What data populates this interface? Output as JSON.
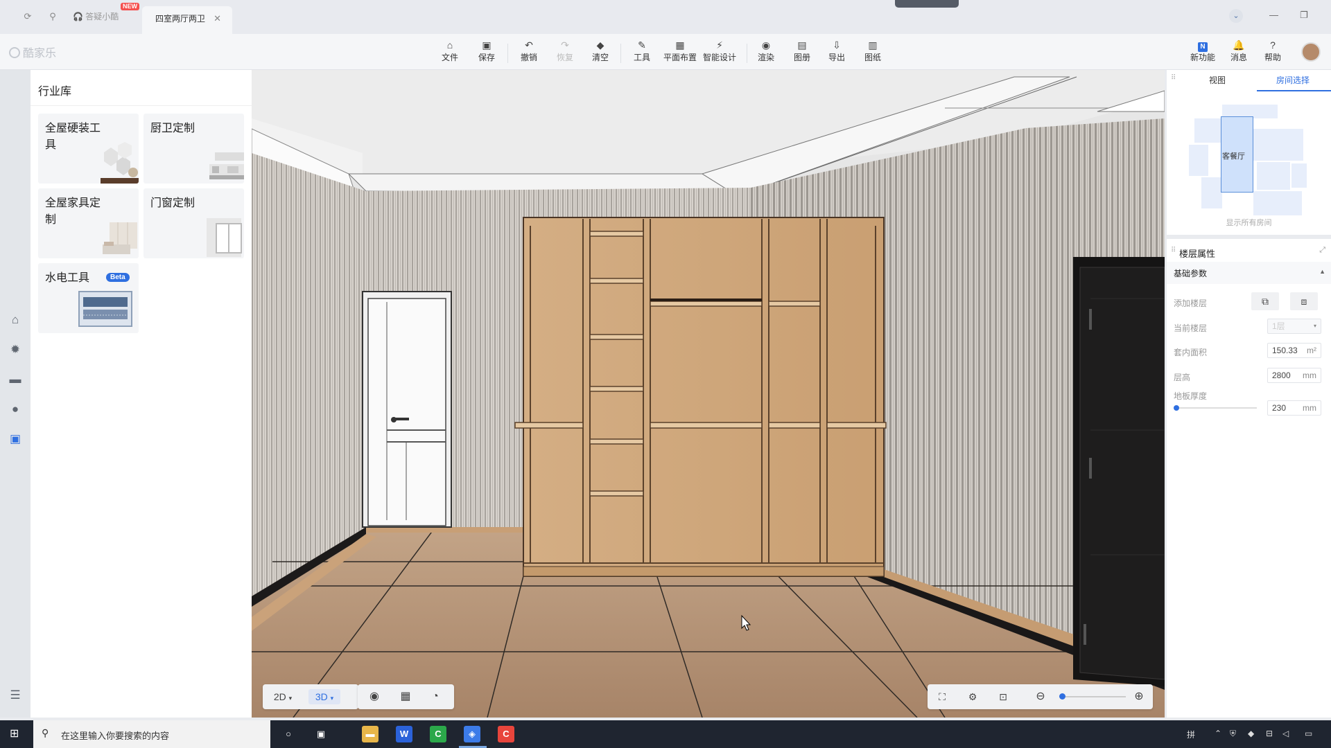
{
  "tabs": {
    "help_tab": "答疑小酷",
    "help_badge": "NEW",
    "active_tab": "四室两厅两卫",
    "close_glyph": "✕"
  },
  "app": {
    "logo_text": "酷家乐"
  },
  "toolbar": {
    "items": [
      {
        "label": "文件",
        "icon": "⌂"
      },
      {
        "label": "保存",
        "icon": "▣"
      },
      {
        "label": "撤销",
        "icon": "↶"
      },
      {
        "label": "恢复",
        "icon": "↷"
      },
      {
        "label": "清空",
        "icon": "◆"
      },
      {
        "label": "工具",
        "icon": "✎"
      },
      {
        "label": "平面布置",
        "icon": "▦"
      },
      {
        "label": "智能设计",
        "icon": "⚡"
      },
      {
        "label": "渲染",
        "icon": "◉"
      },
      {
        "label": "图册",
        "icon": "▤"
      },
      {
        "label": "导出",
        "icon": "⇩"
      },
      {
        "label": "图纸",
        "icon": "▥"
      }
    ],
    "right": [
      {
        "label": "新功能",
        "icon": "N"
      },
      {
        "label": "消息",
        "icon": "🔔"
      },
      {
        "label": "帮助",
        "icon": "?"
      }
    ]
  },
  "library": {
    "title": "行业库",
    "cards": [
      {
        "label": "全屋硬装工具"
      },
      {
        "label": "厨卫定制"
      },
      {
        "label": "全屋家具定制"
      },
      {
        "label": "门窗定制"
      },
      {
        "label": "水电工具",
        "badge": "Beta"
      }
    ]
  },
  "view_controls": {
    "mode_2d": "2D",
    "mode_3d": "3D",
    "active_mode": "3D"
  },
  "room_panel": {
    "tab_view": "视图",
    "tab_room": "房间选择",
    "selected_room": "客餐厅",
    "show_all": "显示所有房间"
  },
  "floor_props": {
    "title": "楼层属性",
    "section": "基础参数",
    "add_floor_label": "添加楼层",
    "current_floor_label": "当前楼层",
    "current_floor_value": "1层",
    "area_label": "套内面积",
    "area_value": "150.33",
    "area_unit": "m²",
    "height_label": "层高",
    "height_value": "2800",
    "height_unit": "mm",
    "thickness_label": "地板厚度",
    "thickness_value": "230",
    "thickness_unit": "mm"
  },
  "taskbar": {
    "search_placeholder": "在这里输入你要搜索的内容",
    "lang": "拼"
  },
  "colors": {
    "accent": "#2f6fe0",
    "wood": "#d2aa7e",
    "floor": "#b8967c",
    "wall": "#cfcac4"
  }
}
